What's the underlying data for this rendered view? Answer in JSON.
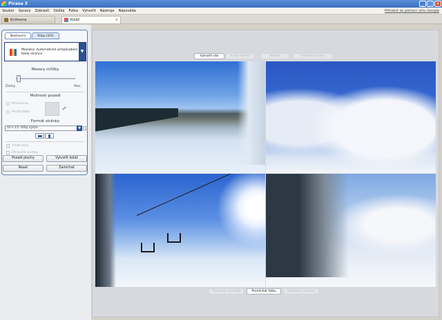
{
  "window": {
    "title": "Picasa 3",
    "controls": {
      "minimize": "_",
      "maximize": "□",
      "close": "×"
    }
  },
  "menu": {
    "items": [
      "Soubor",
      "Úpravy",
      "Zobrazit",
      "Složka",
      "Fotka",
      "Vytvořit",
      "Nástroje",
      "Nápověda"
    ],
    "signin": "Přihlásit se pomocí účtu Google"
  },
  "tabs": {
    "library": "Knihovna",
    "collage": "Koláž",
    "close": "×"
  },
  "panel": {
    "tabs": {
      "settings": "Nastavení",
      "clips": "Klipy (2/4)"
    },
    "layout": {
      "label": "Mozaika: Automatické přizpůsobení fotek stránce",
      "dropdown": "▼"
    },
    "grid_spacing": {
      "title": "Mezery mřížky",
      "min_label": "Žádný",
      "max_label": "Max.",
      "value_fraction": 0.05
    },
    "background": {
      "title": "Možnosti pozadí",
      "option_color": "Plná barva",
      "option_image": "Použít fotku"
    },
    "page_format": {
      "title": "Formát stránky",
      "value": "10 x 15: šířky výšce",
      "dropdown": "▼"
    },
    "checks": {
      "draw_shadows": "Vrhat stíny",
      "outline": "Ohraničit snímky"
    },
    "buttons": {
      "clear": "Pozadí plochy",
      "create": "Vytvořit koláž",
      "reset": "Reset",
      "shuffle": "Zamíchat"
    }
  },
  "workspace": {
    "top_buttons": [
      "Vytvořit vše",
      "Koláž náhled",
      "Náhled",
      "Rozložení fotek"
    ],
    "bottom_buttons": [
      "Proměnit na koláž",
      "Promíchat fotky",
      "Zobrazit v úpravě"
    ]
  }
}
